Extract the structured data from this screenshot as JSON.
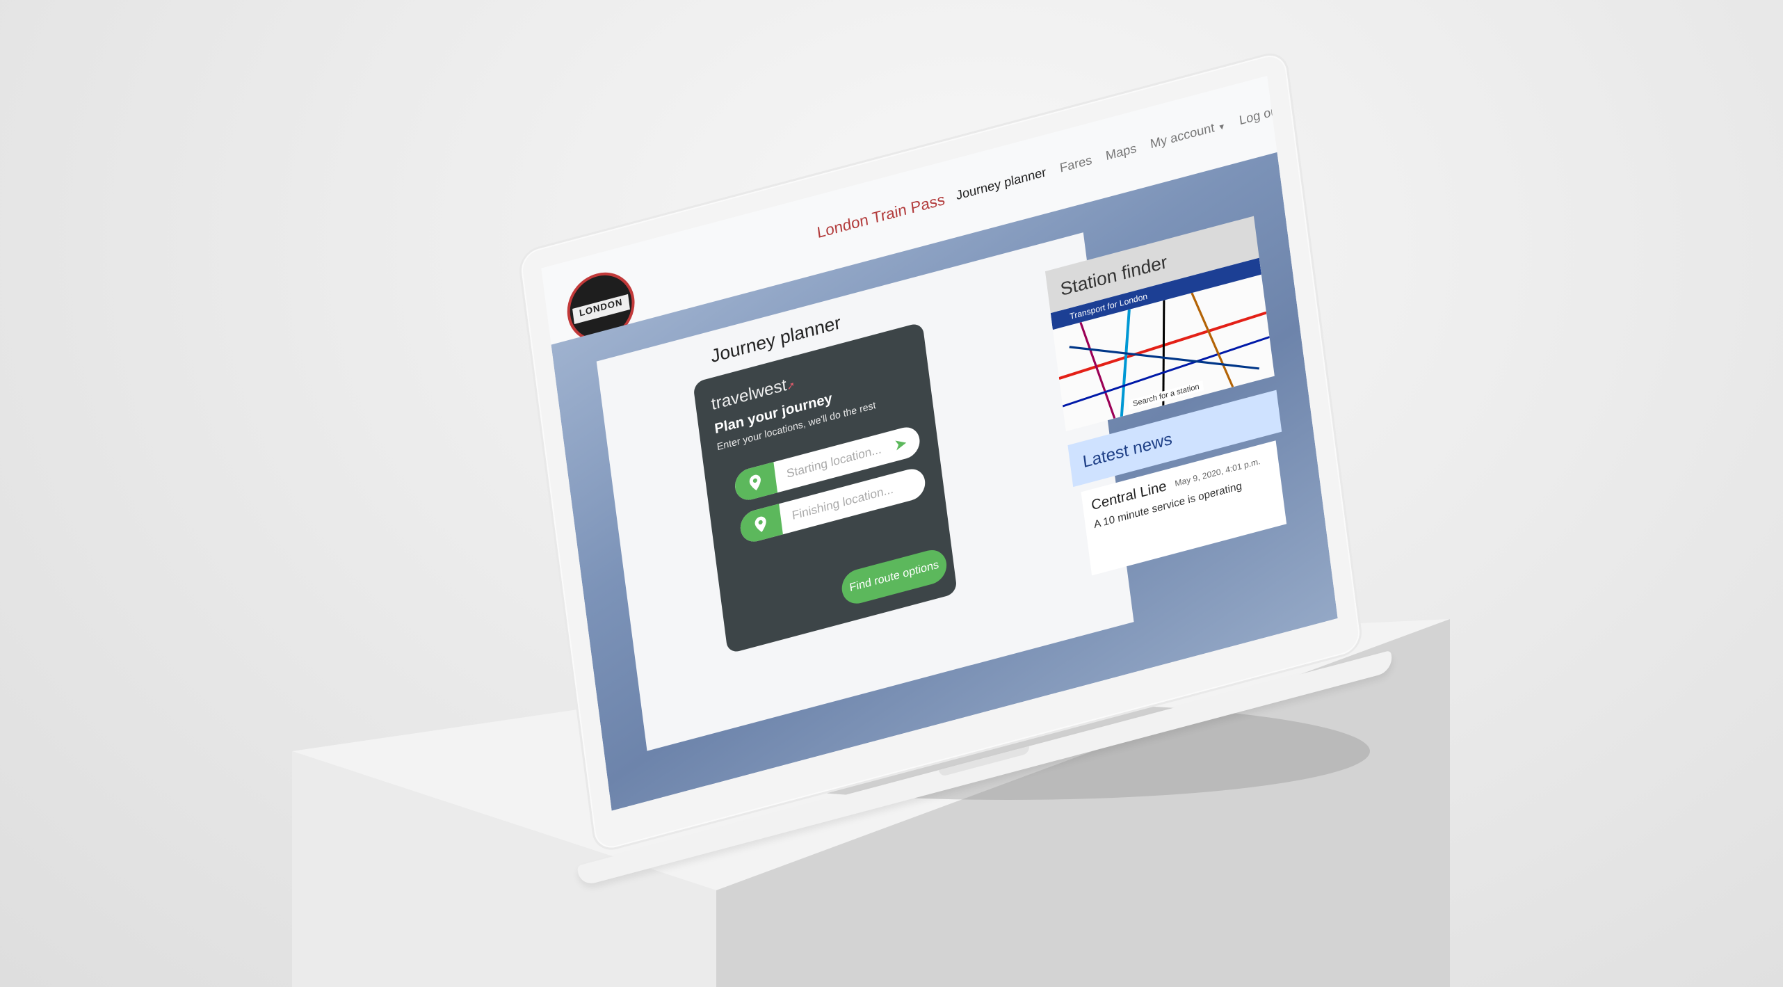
{
  "nav": {
    "brand": "London Train Pass",
    "links": [
      {
        "label": "Journey planner",
        "active": true
      },
      {
        "label": "Fares"
      },
      {
        "label": "Maps"
      },
      {
        "label": "My account"
      },
      {
        "label": "Log out"
      }
    ]
  },
  "logo": {
    "text": "LONDON"
  },
  "planner": {
    "section_title": "Journey planner",
    "widget_logo": "travelwest",
    "heading": "Plan your journey",
    "subheading": "Enter your locations, we'll do the rest",
    "start_placeholder": "Starting location...",
    "finish_placeholder": "Finishing location...",
    "button_label": "Find route options"
  },
  "station_finder": {
    "title": "Station finder",
    "map_banner": "Transport for London",
    "search_label": "Search for a station"
  },
  "news": {
    "title": "Latest news",
    "items": [
      {
        "title": "Central Line",
        "date": "May 9, 2020, 4:01 p.m.",
        "body": "A 10 minute service is operating"
      }
    ]
  },
  "colors": {
    "brand": "#b23b3b",
    "planner_bg": "#3d4548",
    "accent_green": "#5cb85c",
    "news_head": "#cfe2ff"
  }
}
